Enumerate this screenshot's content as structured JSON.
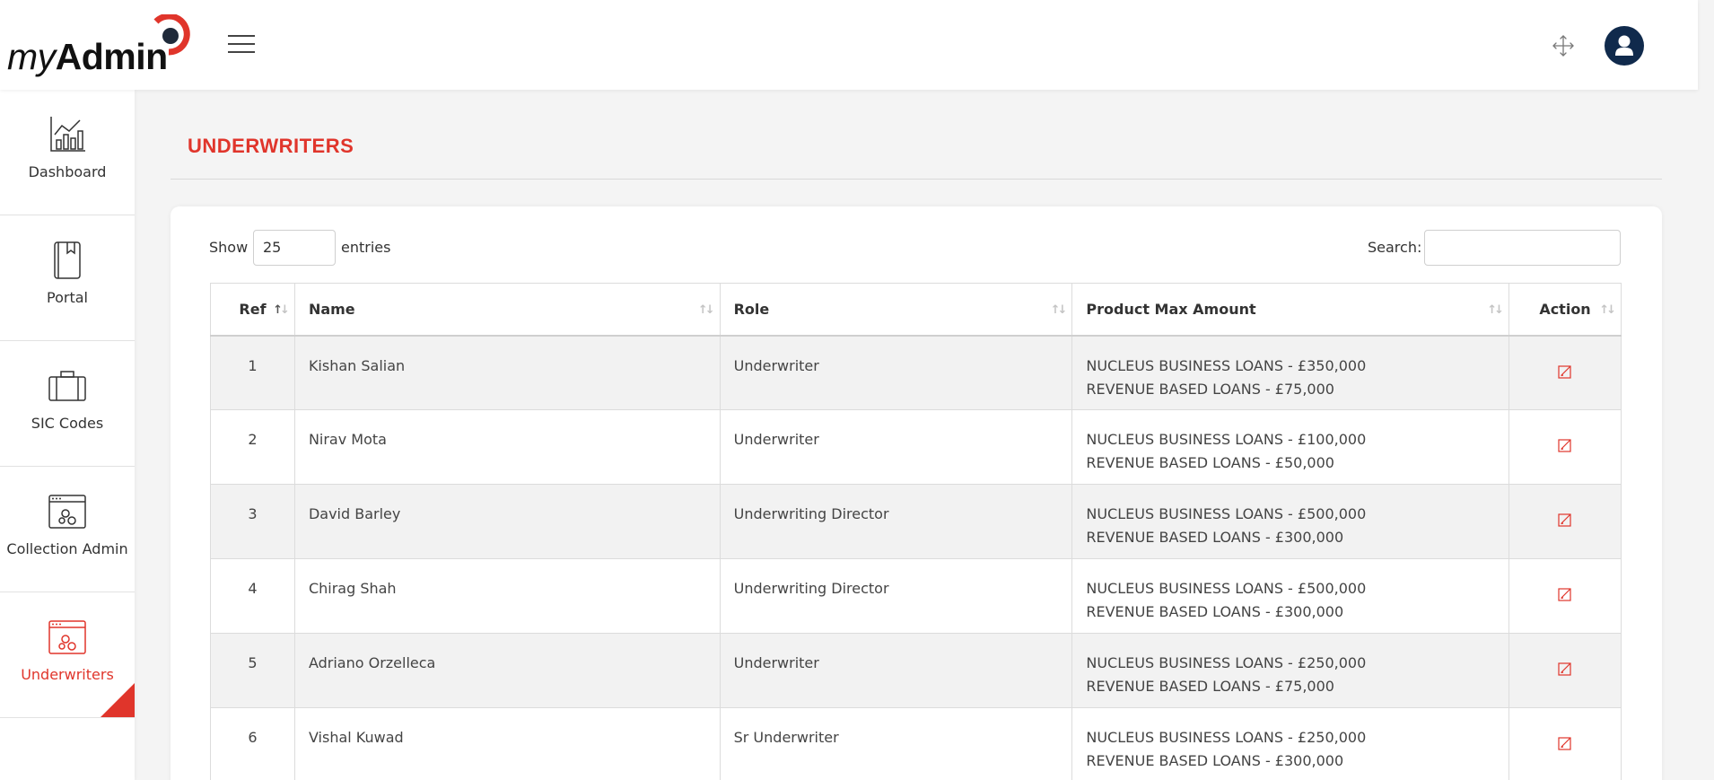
{
  "app": {
    "logo_my": "my",
    "logo_admin": "Admin"
  },
  "header": {
    "menu_icon": "hamburger-icon",
    "fullscreen_icon": "expand-arrows-icon",
    "user_icon": "user-avatar-icon"
  },
  "sidebar": {
    "items": [
      {
        "label": "Dashboard",
        "icon": "chart-icon",
        "active": false
      },
      {
        "label": "Portal",
        "icon": "book-icon",
        "active": false
      },
      {
        "label": "SIC Codes",
        "icon": "briefcase-icon",
        "active": false
      },
      {
        "label": "Collection Admin",
        "icon": "browser-gears-icon",
        "active": false
      },
      {
        "label": "Underwriters",
        "icon": "browser-gears-icon",
        "active": true
      }
    ]
  },
  "page": {
    "title": "UNDERWRITERS"
  },
  "table_controls": {
    "show_label": "Show",
    "page_size": "25",
    "entries_label": "entries",
    "search_label": "Search:",
    "search_value": ""
  },
  "table": {
    "columns": [
      "Ref",
      "Name",
      "Role",
      "Product Max Amount",
      "Action"
    ],
    "rows": [
      {
        "ref": "1",
        "name": "Kishan Salian",
        "role": "Underwriter",
        "amount_1": "NUCLEUS BUSINESS LOANS - £350,000",
        "amount_2": "REVENUE BASED LOANS - £75,000"
      },
      {
        "ref": "2",
        "name": "Nirav Mota",
        "role": "Underwriter",
        "amount_1": "NUCLEUS BUSINESS LOANS - £100,000",
        "amount_2": "REVENUE BASED LOANS - £50,000"
      },
      {
        "ref": "3",
        "name": "David Barley",
        "role": "Underwriting Director",
        "amount_1": "NUCLEUS BUSINESS LOANS - £500,000",
        "amount_2": "REVENUE BASED LOANS - £300,000"
      },
      {
        "ref": "4",
        "name": "Chirag Shah",
        "role": "Underwriting Director",
        "amount_1": "NUCLEUS BUSINESS LOANS - £500,000",
        "amount_2": "REVENUE BASED LOANS - £300,000"
      },
      {
        "ref": "5",
        "name": "Adriano Orzelleca",
        "role": "Underwriter",
        "amount_1": "NUCLEUS BUSINESS LOANS - £250,000",
        "amount_2": "REVENUE BASED LOANS - £75,000"
      },
      {
        "ref": "6",
        "name": "Vishal Kuwad",
        "role": "Sr Underwriter",
        "amount_1": "NUCLEUS BUSINESS LOANS - £250,000",
        "amount_2": "REVENUE BASED LOANS - £300,000"
      }
    ]
  },
  "colors": {
    "accent": "#e0352b",
    "avatar": "#102a4c",
    "stripe": "#f2f2f2"
  }
}
